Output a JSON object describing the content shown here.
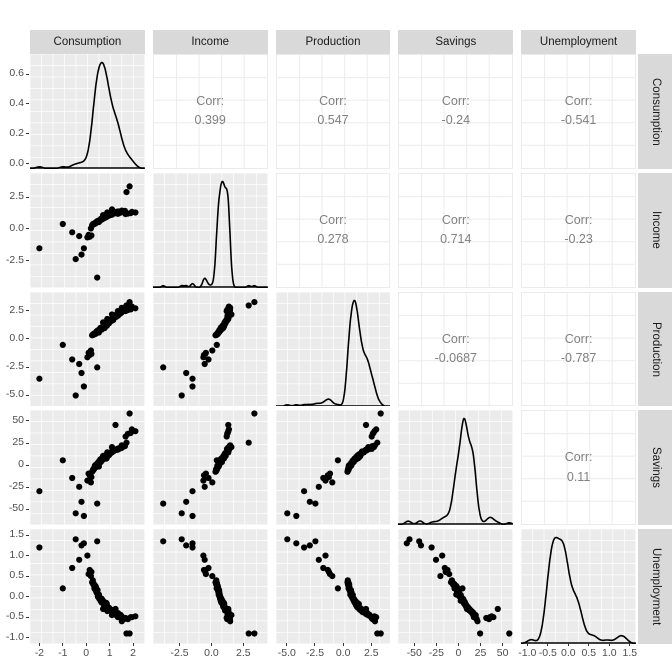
{
  "variables": [
    "Consumption",
    "Income",
    "Production",
    "Savings",
    "Unemployment"
  ],
  "column_strips": [
    {
      "label": "Consumption"
    },
    {
      "label": "Income"
    },
    {
      "label": "Production"
    },
    {
      "label": "Savings"
    },
    {
      "label": "Unemployment"
    }
  ],
  "row_strips": [
    {
      "label": "Consumption"
    },
    {
      "label": "Income"
    },
    {
      "label": "Production"
    },
    {
      "label": "Savings"
    },
    {
      "label": "Unemployment"
    }
  ],
  "corr_label": "Corr:",
  "correlations": {
    "consumption_income": "0.399",
    "consumption_production": "0.547",
    "consumption_savings": "-0.24",
    "consumption_unemployment": "-0.541",
    "income_production": "0.278",
    "income_savings": "0.714",
    "income_unemployment": "-0.23",
    "production_savings": "-0.0687",
    "production_unemployment": "-0.787",
    "savings_unemployment": "0.11"
  },
  "y_axes": [
    {
      "var": "Consumption",
      "ticks": [
        "0.0",
        "0.2",
        "0.4",
        "0.6"
      ],
      "range": [
        -0.04,
        0.78
      ]
    },
    {
      "var": "Income",
      "ticks": [
        "-2.5",
        "0.0",
        "2.5"
      ],
      "range": [
        -4.6,
        4.4
      ]
    },
    {
      "var": "Production",
      "ticks": [
        "-5.0",
        "-2.5",
        "0.0",
        "2.5"
      ],
      "range": [
        -6.0,
        4.2
      ]
    },
    {
      "var": "Savings",
      "ticks": [
        "-50",
        "-25",
        "0",
        "25",
        "50"
      ],
      "range": [
        -68,
        62
      ]
    },
    {
      "var": "Unemployment",
      "ticks": [
        "-1.0",
        "-0.5",
        "0.0",
        "0.5",
        "1.0",
        "1.5"
      ],
      "range": [
        -1.15,
        1.65
      ]
    }
  ],
  "x_axes": [
    {
      "var": "Consumption",
      "ticks": [
        "-2",
        "-1",
        "0",
        "1",
        "2"
      ],
      "range": [
        -2.4,
        2.5
      ]
    },
    {
      "var": "Income",
      "ticks": [
        "-2.5",
        "0.0",
        "2.5"
      ],
      "range": [
        -4.6,
        4.4
      ]
    },
    {
      "var": "Production",
      "ticks": [
        "-5.0",
        "-2.5",
        "0.0",
        "2.5"
      ],
      "range": [
        -6.0,
        4.2
      ]
    },
    {
      "var": "Savings",
      "ticks": [
        "-50",
        "-25",
        "0",
        "25",
        "50"
      ],
      "range": [
        -68,
        62
      ]
    },
    {
      "var": "Unemployment",
      "ticks": [
        "-1.0",
        "-0.5",
        "0.0",
        "0.5",
        "1.0",
        "1.5"
      ],
      "range": [
        -1.15,
        1.65
      ]
    }
  ],
  "chart_data": {
    "type": "scatter",
    "title": "",
    "subtitle": "",
    "plot_kind": "scatterplot-matrix",
    "grid": true,
    "legend": "none",
    "panel_background": "#ebebeb",
    "gridline_color": "#ffffff",
    "point_color": "#000000",
    "density_line_color": "#000000",
    "corr_text_color": "#808080",
    "strip_background": "#d9d9d9",
    "diagonal": "density",
    "lower_triangle": "scatter points",
    "upper_triangle": "pearson correlation text",
    "variables": [
      "Consumption",
      "Income",
      "Production",
      "Savings",
      "Unemployment"
    ],
    "correlation_matrix": [
      [
        1,
        0.399,
        0.547,
        -0.24,
        -0.541
      ],
      [
        0.399,
        1,
        0.278,
        0.714,
        -0.23
      ],
      [
        0.547,
        0.278,
        1,
        -0.0687,
        -0.787
      ],
      [
        -0.24,
        0.714,
        -0.0687,
        1,
        0.11
      ],
      [
        -0.541,
        -0.23,
        -0.787,
        0.11,
        1
      ]
    ],
    "axis_ranges": {
      "Consumption": [
        -2.4,
        2.5
      ],
      "Income": [
        -4.6,
        4.4
      ],
      "Production": [
        -6.0,
        4.2
      ],
      "Savings": [
        -68,
        62
      ],
      "Unemployment": [
        -1.15,
        1.65
      ]
    },
    "density_y_ranges": {
      "Consumption": [
        0,
        0.73
      ],
      "Income": [
        0,
        0.52
      ],
      "Production": [
        0,
        0.31
      ],
      "Savings": [
        0,
        0.046
      ],
      "Unemployment": [
        0,
        1.25
      ]
    },
    "points": {
      "Consumption": [
        0.62,
        0.72,
        0.54,
        0.9,
        1.1,
        0.75,
        0.45,
        0.3,
        1.35,
        0.85,
        0.66,
        1.52,
        0.95,
        0.41,
        0.58,
        1.18,
        0.79,
        0.25,
        1.6,
        0.88,
        0.5,
        0.7,
        1.02,
        0.35,
        1.28,
        0.6,
        0.92,
        0.48,
        1.45,
        0.82,
        0.55,
        0.68,
        1.15,
        0.4,
        1.72,
        0.77,
        0.3,
        0.98,
        1.22,
        0.64,
        0.52,
        0.86,
        1.05,
        0.38,
        1.38,
        0.71,
        0.93,
        0.44,
        1.56,
        0.8,
        0.6,
        0.74,
        1.1,
        0.33,
        1.3,
        0.67,
        0.89,
        0.5,
        1.48,
        0.84,
        0.57,
        0.7,
        1.08,
        0.42,
        1.65,
        0.78,
        0.28,
        0.96,
        1.25,
        0.62,
        -0.1,
        0.2,
        1.85,
        0.88,
        0.53,
        0.72,
        1.04,
        0.36,
        1.33,
        0.69,
        0.9,
        0.46,
        1.5,
        0.81,
        0.58,
        0.73,
        1.12,
        0.39,
        1.4,
        0.76,
        0.31,
        0.99,
        1.2,
        0.63,
        0.51,
        0.85,
        1.06,
        0.37,
        1.36,
        0.7,
        -0.6,
        -1.0,
        -2.0,
        0.1,
        -0.3,
        1.95,
        1.78,
        0.15,
        0.05,
        -0.45,
        2.1,
        1.68,
        0.22,
        -0.2,
        1.9,
        0.47,
        1.25,
        0.6,
        0.95,
        0.42,
        0.66,
        1.14,
        0.48,
        1.3,
        0.74,
        0.59,
        0.87,
        1.0,
        0.44,
        1.42,
        0.71,
        0.33,
        0.94,
        1.18,
        0.65,
        0.5,
        0.8,
        1.09,
        0.4,
        1.35,
        0.68,
        0.91,
        0.47,
        1.46,
        0.83,
        0.56,
        0.76,
        1.13,
        0.38,
        1.28,
        0.72,
        0.29,
        0.97,
        1.21,
        0.61,
        0.54,
        0.88,
        1.03,
        0.43,
        1.32
      ],
      "Income": [
        0.8,
        1.1,
        0.55,
        1.3,
        1.55,
        0.95,
        0.6,
        0.35,
        1.2,
        1.0,
        0.75,
        1.45,
        1.05,
        0.5,
        0.7,
        1.25,
        0.9,
        0.3,
        1.4,
        0.98,
        0.65,
        0.85,
        1.15,
        0.4,
        1.35,
        0.72,
        1.02,
        0.58,
        1.28,
        0.92,
        0.68,
        0.8,
        1.22,
        0.45,
        2.9,
        0.88,
        0.38,
        1.08,
        1.32,
        0.76,
        0.62,
        0.96,
        1.18,
        0.48,
        1.38,
        0.84,
        1.04,
        0.52,
        1.42,
        0.9,
        0.7,
        0.86,
        1.2,
        0.42,
        1.3,
        0.78,
        1.0,
        0.6,
        1.34,
        0.94,
        0.67,
        0.82,
        1.16,
        0.5,
        1.44,
        0.88,
        0.36,
        1.06,
        1.26,
        0.74,
        -1.5,
        0.05,
        3.35,
        0.98,
        0.63,
        0.84,
        1.14,
        0.44,
        1.36,
        0.8,
        1.0,
        0.56,
        1.4,
        0.91,
        0.68,
        0.83,
        1.19,
        0.47,
        1.33,
        0.86,
        0.4,
        1.1,
        1.24,
        0.73,
        0.61,
        0.95,
        1.17,
        0.45,
        1.37,
        0.81,
        -0.25,
        0.4,
        -1.5,
        -0.45,
        -0.55,
        1.35,
        1.22,
        -0.6,
        -0.65,
        -2.35,
        1.3,
        1.18,
        -0.5,
        -2.0,
        1.26,
        -3.8,
        1.3,
        0.7,
        1.05,
        0.52,
        0.76,
        1.21,
        0.58,
        1.31,
        0.85,
        0.69,
        0.97,
        1.09,
        0.54,
        1.29,
        0.82,
        0.43,
        1.04,
        1.23,
        0.75,
        0.6,
        0.9,
        1.12,
        0.5,
        1.34,
        0.78,
        1.01,
        0.57,
        1.39,
        0.93,
        0.66,
        0.86,
        1.2,
        0.48,
        1.27,
        0.83,
        0.39,
        1.07,
        1.25,
        0.71,
        0.64,
        0.98,
        1.13,
        0.53,
        1.3
      ],
      "Production": [
        0.9,
        1.5,
        0.6,
        1.8,
        2.2,
        1.1,
        0.7,
        0.4,
        2.5,
        1.3,
        0.85,
        2.8,
        1.4,
        0.55,
        0.8,
        1.9,
        1.0,
        0.35,
        2.6,
        1.2,
        0.75,
        1.05,
        1.6,
        0.45,
        2.0,
        0.95,
        1.35,
        0.65,
        2.4,
        1.15,
        0.8,
        1.0,
        1.7,
        0.5,
        3.0,
        1.1,
        0.4,
        1.45,
        2.1,
        0.9,
        0.7,
        1.25,
        1.75,
        0.5,
        2.3,
        1.0,
        1.4,
        0.6,
        2.7,
        1.18,
        0.85,
        1.08,
        1.65,
        0.42,
        2.05,
        0.92,
        1.3,
        0.68,
        2.45,
        1.22,
        0.78,
        1.02,
        1.68,
        0.52,
        2.55,
        1.12,
        0.38,
        1.42,
        2.15,
        0.88,
        -4.2,
        -1.0,
        3.3,
        1.25,
        0.72,
        1.06,
        1.62,
        0.46,
        2.08,
        0.96,
        1.38,
        0.62,
        2.35,
        1.14,
        0.82,
        1.04,
        1.72,
        0.48,
        2.18,
        1.08,
        0.41,
        1.48,
        2.02,
        0.9,
        0.74,
        1.2,
        1.64,
        0.47,
        2.12,
        0.98,
        -1.8,
        -0.5,
        -3.5,
        -1.2,
        -2.2,
        2.9,
        2.6,
        -1.4,
        -1.6,
        -5.0,
        2.75,
        2.5,
        -1.3,
        -3.0,
        2.65,
        -2.5,
        2.0,
        0.95,
        1.55,
        0.6,
        1.0,
        1.78,
        0.66,
        2.05,
        1.16,
        0.86,
        1.32,
        1.58,
        0.7,
        2.25,
        1.1,
        0.5,
        1.44,
        1.95,
        0.98,
        0.8,
        1.22,
        1.66,
        0.55,
        2.1,
        1.04,
        1.5,
        0.68,
        2.3,
        1.28,
        0.88,
        1.12,
        1.74,
        0.52,
        2.0,
        1.18,
        0.44,
        1.46,
        1.98,
        1.02,
        0.82,
        1.36,
        1.6,
        0.58,
        2.15
      ],
      "Savings": [
        3,
        10,
        -2,
        14,
        20,
        8,
        1,
        -5,
        18,
        11,
        5,
        22,
        12,
        0,
        4,
        16,
        7,
        -8,
        21,
        9,
        2,
        6,
        13,
        -4,
        17,
        5,
        10,
        0,
        19,
        9,
        4,
        6,
        15,
        -3,
        25,
        8,
        -6,
        11,
        17,
        5,
        1,
        7,
        14,
        -2,
        18,
        6,
        11,
        -1,
        20,
        9,
        4,
        7,
        15,
        -5,
        17,
        5,
        10,
        2,
        19,
        10,
        3,
        6,
        14,
        -1,
        21,
        8,
        -7,
        11,
        17,
        4,
        -58,
        -20,
        58,
        10,
        2,
        7,
        13,
        -3,
        17,
        6,
        11,
        0,
        19,
        9,
        4,
        7,
        15,
        -2,
        18,
        7,
        -5,
        12,
        16,
        5,
        2,
        8,
        14,
        -1,
        18,
        6,
        -15,
        5,
        -30,
        -10,
        -25,
        40,
        35,
        -12,
        -18,
        -55,
        38,
        32,
        -14,
        -42,
        36,
        -44,
        45,
        6,
        13,
        0,
        5,
        15,
        -1,
        17,
        8,
        4,
        9,
        13,
        0,
        19,
        6,
        -4,
        11,
        16,
        7,
        2,
        7,
        14,
        -2,
        17,
        6,
        12,
        -1,
        19,
        9,
        4,
        7,
        15,
        -3,
        17,
        8,
        -6,
        11,
        16,
        6,
        3,
        8,
        13,
        -1,
        18
      ],
      "Unemployment": [
        -0.1,
        -0.3,
        0.05,
        -0.35,
        -0.45,
        -0.2,
        0.1,
        0.3,
        -0.5,
        -0.25,
        -0.05,
        -0.6,
        -0.3,
        0.15,
        -0.02,
        -0.4,
        -0.15,
        0.35,
        -0.55,
        -0.22,
        0.0,
        -0.12,
        -0.32,
        0.2,
        -0.42,
        -0.08,
        -0.28,
        0.08,
        -0.48,
        -0.2,
        -0.04,
        -0.1,
        -0.38,
        0.25,
        -0.9,
        -0.18,
        0.3,
        -0.3,
        -0.44,
        -0.06,
        0.02,
        -0.16,
        -0.34,
        0.18,
        -0.46,
        -0.1,
        -0.3,
        0.12,
        -0.52,
        -0.24,
        -0.06,
        -0.14,
        -0.36,
        0.28,
        -0.4,
        -0.08,
        -0.26,
        0.06,
        -0.5,
        -0.26,
        -0.02,
        -0.12,
        -0.33,
        0.22,
        -0.54,
        -0.2,
        0.4,
        -0.3,
        -0.43,
        -0.05,
        1.3,
        0.5,
        -0.9,
        -0.24,
        0.0,
        -0.13,
        -0.31,
        0.24,
        -0.41,
        -0.09,
        -0.28,
        0.1,
        -0.47,
        -0.21,
        -0.03,
        -0.11,
        -0.37,
        0.26,
        -0.45,
        -0.17,
        0.32,
        -0.32,
        -0.4,
        -0.07,
        0.01,
        -0.15,
        -0.35,
        0.2,
        -0.43,
        -0.1,
        0.7,
        0.2,
        1.2,
        0.55,
        0.9,
        -0.5,
        -0.55,
        0.65,
        1.0,
        1.4,
        -0.48,
        -0.52,
        0.6,
        1.25,
        -0.5,
        1.35,
        -0.3,
        -0.06,
        -0.34,
        0.14,
        -0.1,
        -0.36,
        0.16,
        -0.42,
        -0.18,
        -0.04,
        -0.22,
        -0.3,
        0.1,
        -0.46,
        -0.12,
        0.3,
        -0.28,
        -0.38,
        -0.14,
        0.02,
        -0.16,
        -0.33,
        0.18,
        -0.4,
        -0.11,
        -0.29,
        0.12,
        -0.44,
        -0.2,
        -0.05,
        -0.13,
        -0.35,
        0.22,
        -0.39,
        -0.15,
        0.34,
        -0.27,
        -0.37,
        -0.1,
        0.04,
        -0.18,
        -0.31,
        0.16,
        -0.42
      ]
    }
  }
}
